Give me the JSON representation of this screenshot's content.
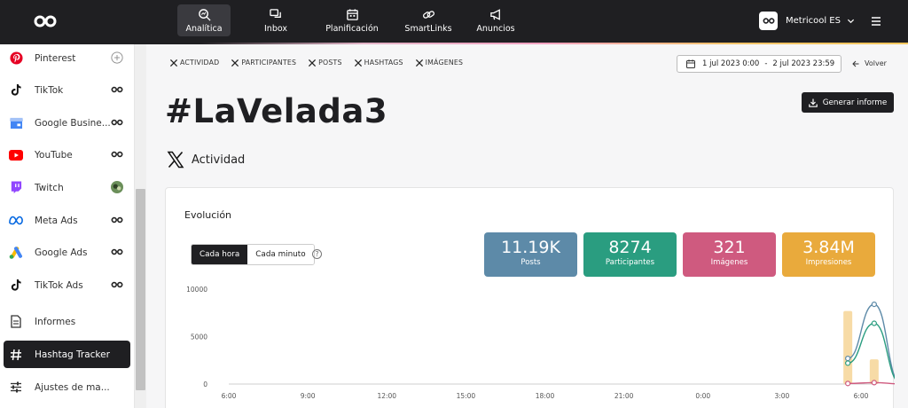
{
  "nav": {
    "items": [
      {
        "label": "Analítica",
        "icon": "analytics-icon",
        "active": true
      },
      {
        "label": "Inbox",
        "icon": "chat-icon",
        "active": false
      },
      {
        "label": "Planificación",
        "icon": "calendar-icon",
        "active": false
      },
      {
        "label": "SmartLinks",
        "icon": "link-icon",
        "active": false
      },
      {
        "label": "Anuncios",
        "icon": "megaphone-icon",
        "active": false
      }
    ]
  },
  "account": {
    "name": "Metricool ES"
  },
  "sidebar": {
    "items": [
      {
        "label": "Pinterest",
        "icon": "pinterest-icon"
      },
      {
        "label": "TikTok",
        "icon": "tiktok-icon"
      },
      {
        "label": "Google Busine...",
        "icon": "google-business-icon"
      },
      {
        "label": "YouTube",
        "icon": "youtube-icon"
      },
      {
        "label": "Twitch",
        "icon": "twitch-icon"
      },
      {
        "label": "Meta Ads",
        "icon": "meta-icon"
      },
      {
        "label": "Google Ads",
        "icon": "google-ads-icon"
      },
      {
        "label": "TikTok Ads",
        "icon": "tiktok-icon"
      },
      {
        "label": "Informes",
        "icon": "report-icon"
      },
      {
        "label": "Hashtag Tracker",
        "icon": "hashtag-icon"
      },
      {
        "label": "Ajustes de ma...",
        "icon": "sliders-icon"
      }
    ]
  },
  "tabs": [
    "ACTIVIDAD",
    "PARTICIPANTES",
    "POSTS",
    "HASHTAGS",
    "IMÁGENES"
  ],
  "date_range": {
    "start": "1 jul 2023 0:00",
    "separator": "-",
    "end": "2 jul 2023 23:59"
  },
  "back_label": "Volver",
  "page_title": "#LaVelada3",
  "report_button": "Generar informe",
  "section_title": "Actividad",
  "card": {
    "title": "Evolución",
    "toggle": {
      "hour": "Cada hora",
      "minute": "Cada minuto"
    },
    "help": "?",
    "metrics": [
      {
        "value": "11.19K",
        "label": "Posts",
        "color": "#5d8aa8"
      },
      {
        "value": "8274",
        "label": "Participantes",
        "color": "#2a9d80"
      },
      {
        "value": "321",
        "label": "Imágenes",
        "color": "#cf5a7f"
      },
      {
        "value": "3.84M",
        "label": "Impresiones",
        "color": "#e9aa3c"
      }
    ]
  },
  "chart_data": {
    "type": "line",
    "y_ticks": [
      "10000",
      "5000",
      "0"
    ],
    "ylim": [
      0,
      10000
    ],
    "x_ticks": [
      "6:00",
      "9:00",
      "12:00",
      "15:00",
      "18:00",
      "21:00",
      "0:00",
      "3:00",
      "6:00"
    ],
    "series": [
      {
        "color": "#f2c36b",
        "kind": "bar",
        "x": [
          26,
          27
        ],
        "values": [
          7700,
          2600
        ]
      },
      {
        "color": "#5d8aa8",
        "kind": "line",
        "x": [
          26,
          27,
          28
        ],
        "values": [
          2700,
          8400,
          100
        ]
      },
      {
        "color": "#2a9d80",
        "kind": "line",
        "x": [
          26,
          27,
          28
        ],
        "values": [
          2200,
          6400,
          100
        ]
      },
      {
        "color": "#cf5a7f",
        "kind": "line",
        "x": [
          26,
          27,
          28
        ],
        "values": [
          60,
          150,
          20
        ]
      }
    ]
  }
}
